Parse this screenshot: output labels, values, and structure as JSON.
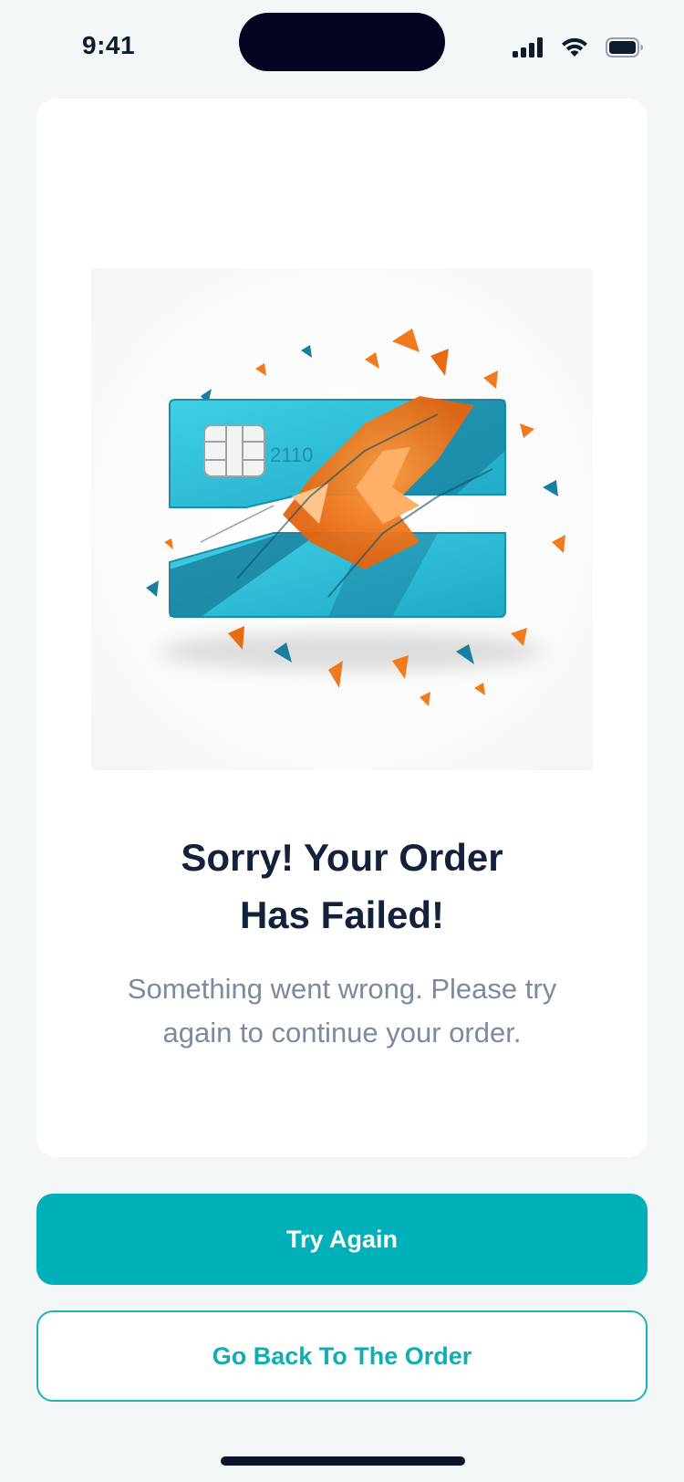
{
  "status_bar": {
    "time": "9:41",
    "icons": [
      "cellular-signal-icon",
      "wifi-icon",
      "battery-icon"
    ]
  },
  "illustration": {
    "name": "broken-credit-card-illustration",
    "card_number_fragment": "2110",
    "colors": {
      "card": "#2ec4dc",
      "card_dark": "#1a7f9e",
      "shard": "#f07a1c"
    }
  },
  "message": {
    "title_line1": "Sorry! Your Order",
    "title_line2": "Has Failed!",
    "subtitle_line1": "Something went wrong. Please try",
    "subtitle_line2": "again to continue your order."
  },
  "actions": {
    "primary_label": "Try Again",
    "secondary_label": "Go Back To The Order"
  },
  "colors": {
    "accent": "#00b0b8",
    "title": "#14213a",
    "subtitle": "#7c8aa0",
    "background": "#f4f7f8"
  }
}
